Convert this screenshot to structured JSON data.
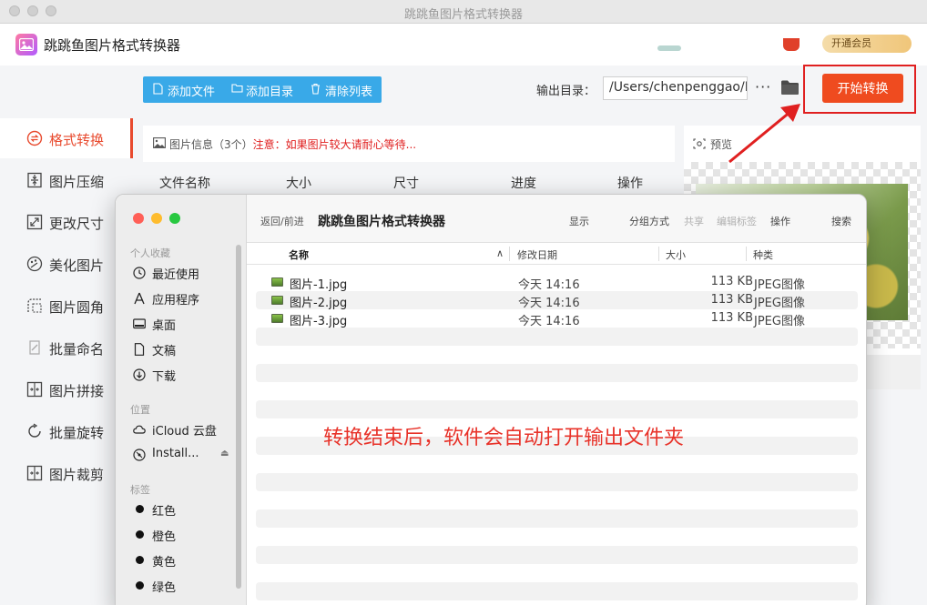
{
  "window": {
    "title": "跳跳鱼图片格式转换器"
  },
  "app": {
    "name": "跳跳鱼图片格式转换器",
    "badge_text": "开通会员"
  },
  "sidebar": {
    "items": [
      {
        "label": "格式转换",
        "active": true
      },
      {
        "label": "图片压缩"
      },
      {
        "label": "更改尺寸"
      },
      {
        "label": "美化图片"
      },
      {
        "label": "图片圆角"
      },
      {
        "label": "批量命名"
      },
      {
        "label": "图片拼接"
      },
      {
        "label": "批量旋转"
      },
      {
        "label": "图片裁剪"
      }
    ]
  },
  "toolbar": {
    "add_file": "添加文件",
    "add_dir": "添加目录",
    "clear_list": "清除列表",
    "output_label": "输出目录：",
    "output_path": "/Users/chenpenggao/D",
    "more": "···",
    "start": "开始转换"
  },
  "info": {
    "title": "图片信息（3个）",
    "warning": "注意：如果图片较大请耐心等待..."
  },
  "table": {
    "columns": [
      "文件名称",
      "大小",
      "尺寸",
      "进度",
      "操作"
    ]
  },
  "preview": {
    "title": "预览"
  },
  "finder": {
    "nav": "返回/前进",
    "title": "跳跳鱼图片格式转换器",
    "actions": [
      "显示",
      "分组方式",
      "共享",
      "编辑标签",
      "操作",
      "搜索"
    ],
    "sections": {
      "favorites": "个人收藏",
      "locations": "位置",
      "tags": "标签"
    },
    "favorites": [
      "最近使用",
      "应用程序",
      "桌面",
      "文稿",
      "下载"
    ],
    "locations": [
      "iCloud 云盘",
      "Install..."
    ],
    "tags": [
      "红色",
      "橙色",
      "黄色",
      "绿色"
    ],
    "columns": {
      "name": "名称",
      "date": "修改日期",
      "size": "大小",
      "kind": "种类"
    },
    "files": [
      {
        "name": "图片-1.jpg",
        "date": "今天 14:16",
        "size": "113 KB",
        "kind": "JPEG图像"
      },
      {
        "name": "图片-2.jpg",
        "date": "今天 14:16",
        "size": "113 KB",
        "kind": "JPEG图像"
      },
      {
        "name": "图片-3.jpg",
        "date": "今天 14:16",
        "size": "113 KB",
        "kind": "JPEG图像"
      }
    ]
  },
  "annotation": {
    "text": "转换结束后，软件会自动打开输出文件夹"
  },
  "colors": {
    "accent": "#ef4b1f",
    "toolbar_blue": "#39a9e8",
    "annotation_red": "#e8332a"
  }
}
